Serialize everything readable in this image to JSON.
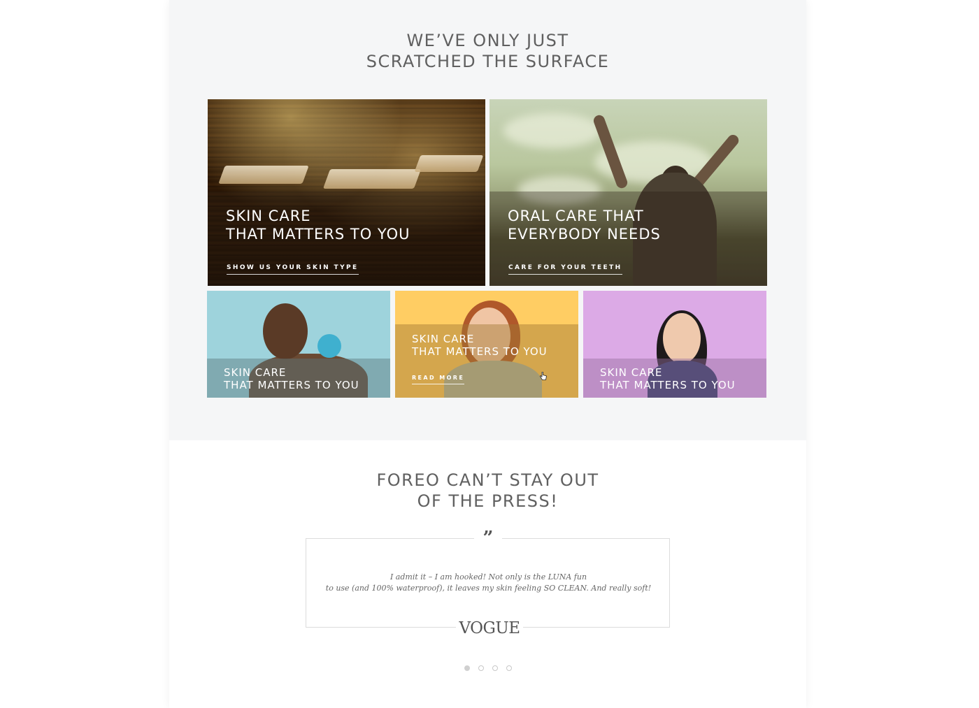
{
  "surface": {
    "heading": [
      "WE’VE ONLY JUST",
      "SCRATCHED THE SURFACE"
    ],
    "tiles": [
      {
        "title": [
          "SKIN CARE",
          "THAT MATTERS TO YOU"
        ],
        "cta": "SHOW US YOUR SKIN TYPE"
      },
      {
        "title": [
          "ORAL CARE THAT",
          "EVERYBODY NEEDS"
        ],
        "cta": "CARE FOR YOUR TEETH"
      },
      {
        "title": [
          "SKIN CARE",
          "THAT MATTERS TO YOU"
        ]
      },
      {
        "title": [
          "SKIN CARE",
          "THAT MATTERS TO YOU"
        ],
        "cta": "READ MORE"
      },
      {
        "title": [
          "SKIN CARE",
          "THAT MATTERS TO YOU"
        ]
      }
    ]
  },
  "press": {
    "heading": [
      "FOREO CAN’T STAY OUT",
      "OF THE PRESS!"
    ],
    "quote_mark": "”",
    "quote": [
      "I admit it – I am hooked! Not only is the LUNA fun",
      "to use (and 100% waterproof), it leaves my skin feeling SO CLEAN. And really soft!"
    ],
    "source": "VOGUE",
    "slides": 4,
    "active_slide": 1
  },
  "colors": {
    "band": "#f5f6f7",
    "tile_blue": "#9ed3dc",
    "tile_yellow": "#ffcd63",
    "tile_purple": "#dcaae6"
  },
  "icons": {
    "quote": "quote-icon",
    "cursor": "hand-cursor-icon"
  }
}
